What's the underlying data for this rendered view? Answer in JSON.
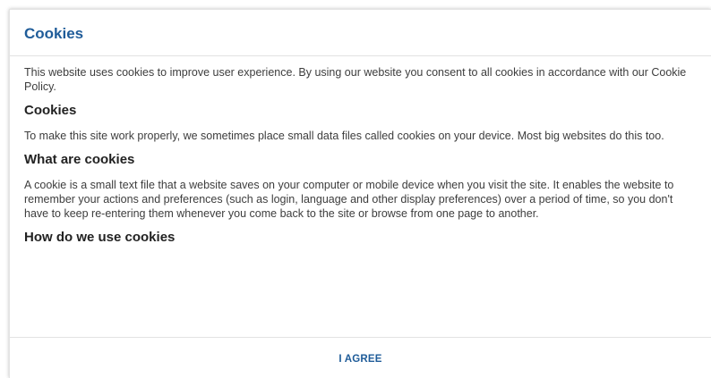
{
  "dialog": {
    "title": "Cookies",
    "intro": "This website uses cookies to improve user experience. By using our website you consent to all cookies in accordance with our Cookie Policy.",
    "sections": [
      {
        "heading": "Cookies",
        "text": "To make this site work properly, we sometimes place small data files called cookies on your device. Most big websites do this too."
      },
      {
        "heading": "What are cookies",
        "text": "A cookie is a small text file that a website saves on your computer or mobile device when you visit the site. It enables the website to remember your actions and preferences (such as login, language and other display preferences) over a period of time, so you don't have to keep re-entering them whenever you come back to the site or browse from one page to another."
      },
      {
        "heading": "How do we use cookies",
        "text": ""
      }
    ],
    "agree_label": "I AGREE"
  },
  "colors": {
    "accent": "#1f5c99",
    "text": "#3d3d3d",
    "heading": "#222222",
    "divider": "#e2e2e2"
  }
}
